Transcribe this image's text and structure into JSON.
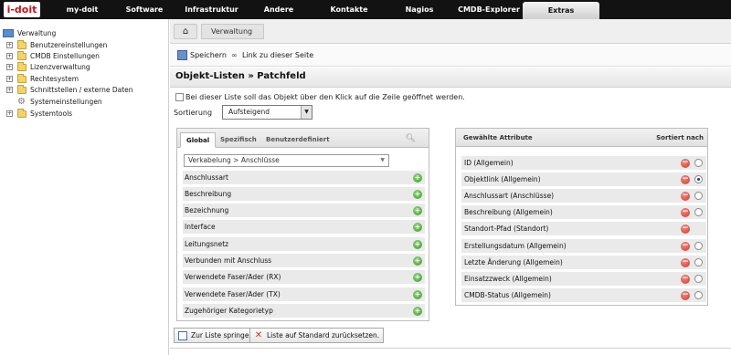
{
  "logo": "i-doit",
  "nav": [
    {
      "label": "my-doit"
    },
    {
      "label": "Software"
    },
    {
      "label": "Infrastruktur"
    },
    {
      "label": "Andere"
    },
    {
      "label": "Kontakte"
    },
    {
      "label": "Nagios"
    },
    {
      "label": "CMDB-Explorer"
    },
    {
      "label": "Extras",
      "active": true
    }
  ],
  "tree": {
    "root": "Verwaltung",
    "items": [
      {
        "label": "Benutzereinstellungen"
      },
      {
        "label": "CMDB Einstellungen"
      },
      {
        "label": "Lizenzverwaltung"
      },
      {
        "label": "Rechtesystem"
      },
      {
        "label": "Schnittstellen / externe Daten"
      },
      {
        "label": "Systemeinstellungen"
      },
      {
        "label": "Systemtools"
      }
    ]
  },
  "breadcrumb": {
    "item": "Verwaltung"
  },
  "toolbar": {
    "save": "Speichern",
    "link": "Link zu dieser Seite"
  },
  "page_title": "Objekt-Listen » Patchfeld",
  "checkbox": {
    "label": "Bei dieser Liste soll das Objekt über den Klick auf die Zeile geöffnet werden.",
    "checked": false
  },
  "sort": {
    "label": "Sortierung",
    "value": "Aufsteigend"
  },
  "tabs": [
    {
      "label": "Global",
      "active": true
    },
    {
      "label": "Spezifisch"
    },
    {
      "label": "Benutzerdefiniert"
    }
  ],
  "category_select": "Verkabelung > Anschlüsse",
  "available_attributes": [
    "Anschlussart",
    "Beschreibung",
    "Bezeichnung",
    "Interface",
    "Leitungsnetz",
    "Verbunden mit Anschluss",
    "Verwendete Faser/Ader (RX)",
    "Verwendete Faser/Ader (TX)",
    "Zugehöriger Kategorietyp"
  ],
  "selected_panel": {
    "header_left": "Gewählte Attribute",
    "header_right": "Sortiert nach"
  },
  "selected_attributes": [
    {
      "label": "ID (Allgemein)",
      "radio": true,
      "checked": false
    },
    {
      "label": "Objektlink (Allgemein)",
      "radio": true,
      "checked": true
    },
    {
      "label": "Anschlussart (Anschlüsse)",
      "radio": true,
      "checked": false
    },
    {
      "label": "Beschreibung (Allgemein)",
      "radio": true,
      "checked": false
    },
    {
      "label": "Standort-Pfad (Standort)",
      "radio": false,
      "checked": false
    },
    {
      "label": "Erstellungsdatum (Allgemein)",
      "radio": true,
      "checked": false
    },
    {
      "label": "Letzte Änderung (Allgemein)",
      "radio": true,
      "checked": false
    },
    {
      "label": "Einsatzzweck (Allgemein)",
      "radio": true,
      "checked": false
    },
    {
      "label": "CMDB-Status (Allgemein)",
      "radio": true,
      "checked": false
    }
  ],
  "bottom_buttons": {
    "jump": "Zur Liste springen",
    "reset": "Liste auf Standard zurücksetzen."
  }
}
